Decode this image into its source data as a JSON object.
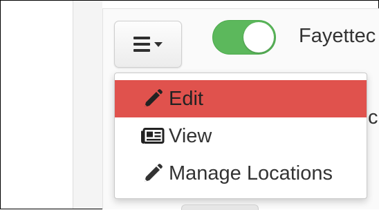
{
  "header": {
    "location_title": "Fayettec",
    "partial_text": "c"
  },
  "toggle": {
    "state": "on",
    "color": "#5cb85c"
  },
  "menu_button": {
    "icon": "hamburger-icon",
    "caret_icon": "caret-down-icon"
  },
  "dropdown": {
    "items": [
      {
        "label": "Edit",
        "icon": "pencil-icon",
        "active": true
      },
      {
        "label": "View",
        "icon": "newspaper-icon",
        "active": false
      },
      {
        "label": "Manage Locations",
        "icon": "pencil-icon",
        "active": false
      }
    ],
    "active_color": "#e0524d"
  }
}
